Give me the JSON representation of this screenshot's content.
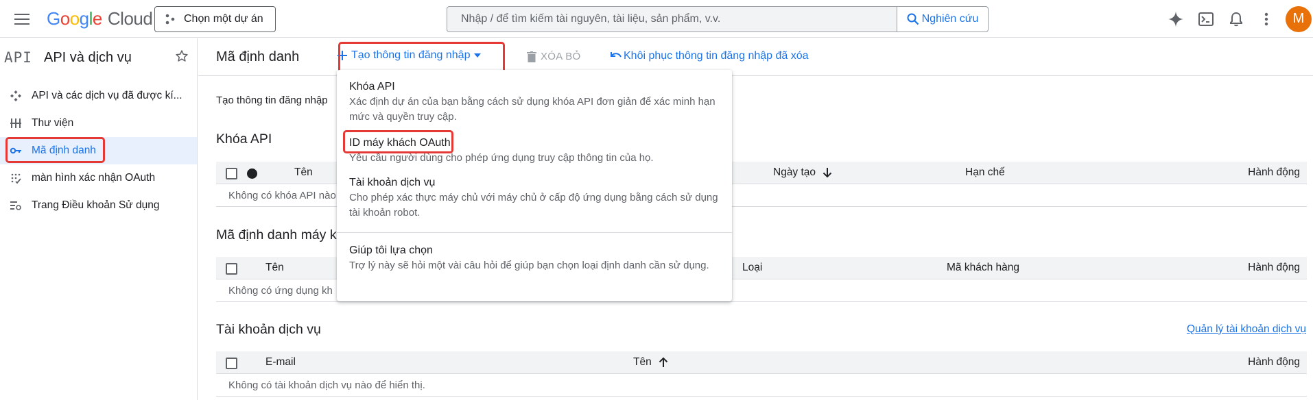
{
  "topbar": {
    "logo_google": [
      "G",
      "o",
      "o",
      "g",
      "l",
      "e"
    ],
    "logo_cloud": "Cloud",
    "project_label": "Chọn một dự án",
    "search_placeholder": "Nhập / để tìm kiếm tài nguyên, tài liệu, sản phẩm, v.v.",
    "search_button": "Nghiên cứu",
    "avatar_letter": "M"
  },
  "sidebar": {
    "logo_text": "API",
    "title": "API và dịch vụ",
    "items": [
      {
        "label": "API và các dịch vụ đã được kí...",
        "icon": "api-services-icon"
      },
      {
        "label": "Thư viện",
        "icon": "library-icon"
      },
      {
        "label": "Mã định danh",
        "icon": "key-icon",
        "active": true
      },
      {
        "label": "màn hình xác nhận OAuth",
        "icon": "consent-icon"
      },
      {
        "label": "Trang Điều khoản Sử dụng",
        "icon": "terms-icon"
      }
    ]
  },
  "main": {
    "title": "Mã định danh",
    "create_label": "Tạo thông tin đăng nhập",
    "delete_label": "XÓA BỎ",
    "restore_label": "Khôi phục thông tin đăng nhập đã xóa",
    "intro": "Tạo thông tin đăng nhập",
    "api_keys": {
      "title": "Khóa API",
      "col_name": "Tên",
      "col_created": "Ngày tạo",
      "col_restrict": "Hạn chế",
      "col_actions": "Hành động",
      "empty": "Không có khóa API nào"
    },
    "oauth": {
      "title": "Mã định danh máy k",
      "col_name": "Tên",
      "col_type": "Loại",
      "col_client": "Mã khách hàng",
      "col_actions": "Hành động",
      "empty": "Không có ứng dụng kh"
    },
    "service": {
      "title": "Tài khoản dịch vụ",
      "manage_link": "Quản lý tài khoản dịch vụ",
      "col_email": "E-mail",
      "col_name": "Tên",
      "col_actions": "Hành động",
      "empty": "Không có tài khoản dịch vụ nào để hiển thị."
    }
  },
  "dropdown": {
    "items": [
      {
        "label": "Khóa API",
        "desc": "Xác định dự án của bạn bằng cách sử dụng khóa API đơn giản để xác minh hạn mức và quyền truy cập."
      },
      {
        "label": "ID máy khách OAuth",
        "desc": "Yêu cầu người dùng cho phép ứng dụng truy cập thông tin của họ."
      },
      {
        "label": "Tài khoản dịch vụ",
        "desc": "Cho phép xác thực máy chủ với máy chủ ở cấp độ ứng dụng bằng cách sử dụng tài khoản robot."
      },
      {
        "label": "Giúp tôi lựa chọn",
        "desc": "Trợ lý này sẽ hỏi một vài câu hỏi để giúp bạn chọn loại định danh cần sử dụng."
      }
    ]
  },
  "colors": {
    "accent": "#1a73e8",
    "highlight": "#e53935",
    "avatar": "#e8710a"
  }
}
